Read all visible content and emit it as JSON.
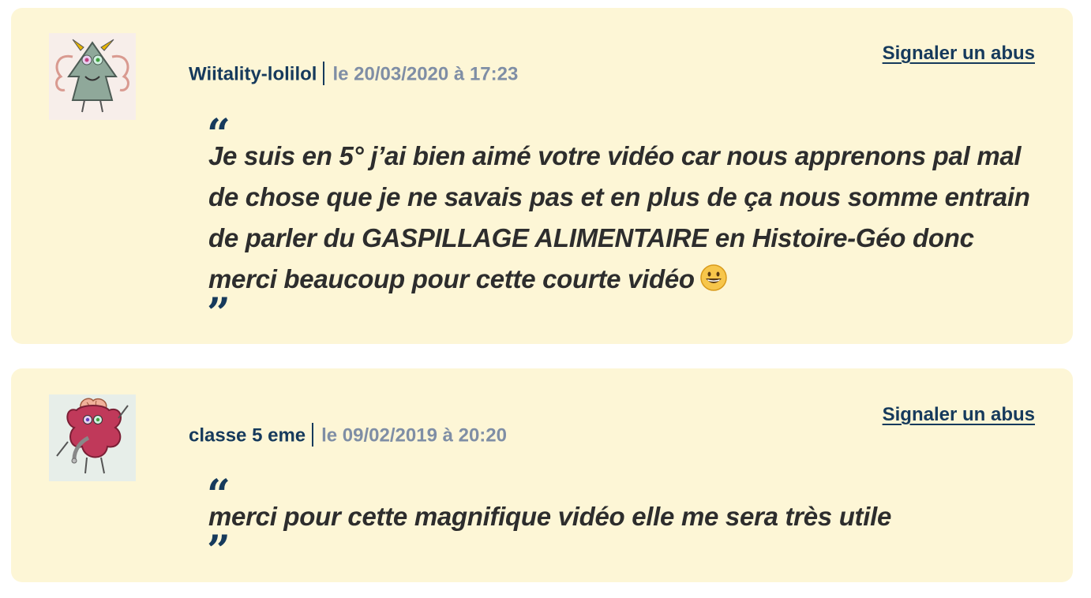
{
  "comments": [
    {
      "author": "Wiitality-lolilol",
      "date": "le 20/03/2020 à 17:23",
      "report_label": "Signaler un abus",
      "message": "Je suis en 5° j’ai bien aimé votre vidéo car nous apprenons pal mal de chose que je ne savais pas et en plus de ça nous somme entrain de parler du GASPILLAGE ALIMENTAIRE en Histoire-Géo donc merci beaucoup pour cette courte vidéo",
      "emoji": "grinning-face-emoji",
      "avatar_icon": "green-monster-avatar-icon"
    },
    {
      "author": "classe 5 eme",
      "date": "le 09/02/2019 à 20:20",
      "report_label": "Signaler un abus",
      "message": "merci pour cette magnifique vidéo elle me sera très utile",
      "avatar_icon": "red-monster-avatar-icon"
    }
  ],
  "quote_marks": {
    "open": "“",
    "close": "”"
  },
  "colors": {
    "card_background": "#fdf6d6",
    "author": "#163a5c",
    "date": "#7f8ea5",
    "message": "#2d2d2d"
  }
}
